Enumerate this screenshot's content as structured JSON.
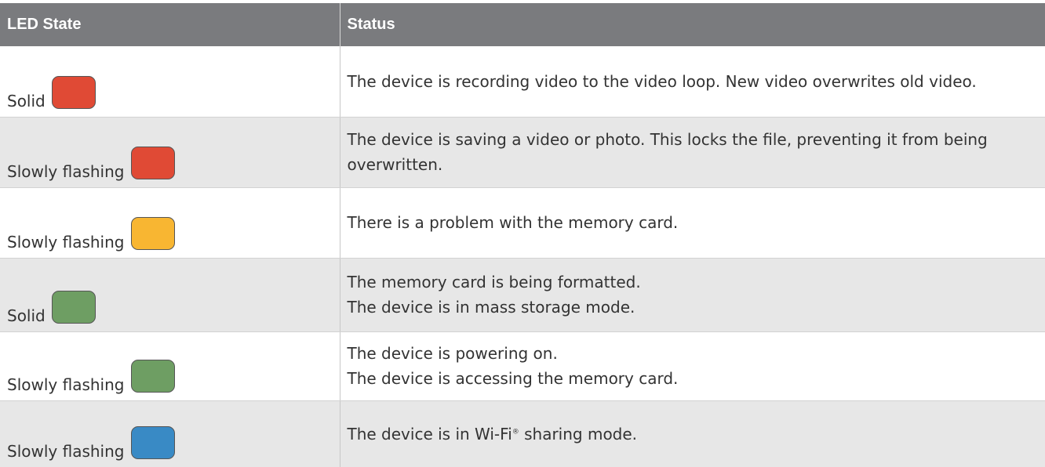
{
  "table": {
    "headers": [
      "LED State",
      "Status"
    ],
    "rows": [
      {
        "state": "Solid",
        "led_color": "#e04a35",
        "led_icon": "red-led-icon",
        "status": [
          "The device is recording video to the video loop. New video overwrites old video."
        ]
      },
      {
        "state": "Slowly flashing",
        "led_color": "#e04a35",
        "led_icon": "red-led-icon",
        "status": [
          "The device is saving a video or photo. This locks the file, preventing it from being overwritten."
        ]
      },
      {
        "state": "Slowly flashing",
        "led_color": "#f8b632",
        "led_icon": "yellow-led-icon",
        "status": [
          "There is a problem with the memory card."
        ]
      },
      {
        "state": "Solid",
        "led_color": "#6e9e63",
        "led_icon": "green-led-icon",
        "status": [
          "The memory card is being formatted.",
          "The device is in mass storage mode."
        ]
      },
      {
        "state": "Slowly flashing",
        "led_color": "#6e9e63",
        "led_icon": "green-led-icon",
        "status": [
          "The device is powering on.",
          "The device is accessing the memory card."
        ]
      },
      {
        "state": "Slowly flashing",
        "led_color": "#398ac5",
        "led_icon": "blue-led-icon",
        "status_parts": {
          "before": "The device is in Wi-Fi",
          "reg": "®",
          "after": " sharing mode."
        }
      }
    ]
  }
}
